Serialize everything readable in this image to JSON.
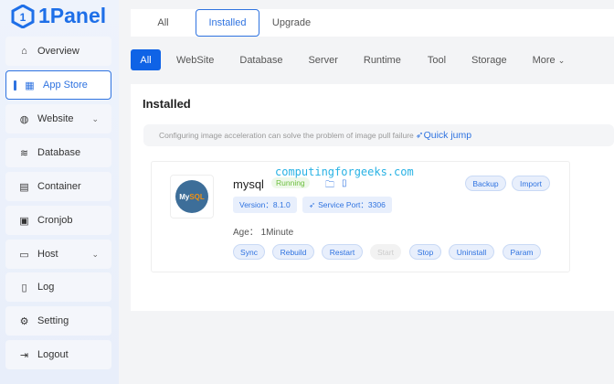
{
  "brand": {
    "name": "1Panel"
  },
  "sidebar": {
    "items": [
      {
        "label": "Overview",
        "icon": "home-icon"
      },
      {
        "label": "App Store",
        "icon": "grid-icon",
        "active": true
      },
      {
        "label": "Website",
        "icon": "globe-icon",
        "chevron": true
      },
      {
        "label": "Database",
        "icon": "database-icon"
      },
      {
        "label": "Container",
        "icon": "docker-icon"
      },
      {
        "label": "Cronjob",
        "icon": "calendar-icon"
      },
      {
        "label": "Host",
        "icon": "host-icon",
        "chevron": true
      },
      {
        "label": "Log",
        "icon": "log-icon"
      },
      {
        "label": "Setting",
        "icon": "gear-icon"
      },
      {
        "label": "Logout",
        "icon": "logout-icon"
      }
    ]
  },
  "tabs": [
    "All",
    "Installed",
    "Upgrade"
  ],
  "categories": [
    "All",
    "WebSite",
    "Database",
    "Server",
    "Runtime",
    "Tool",
    "Storage",
    "More"
  ],
  "panel": {
    "title": "Installed",
    "notice": "Configuring image acceleration can solve the problem of image pull failure",
    "notice_link": "Quick jump",
    "app": {
      "name": "mysql",
      "status": "Running",
      "logo_text": "MySQL",
      "version": "Version：8.1.0",
      "port": "Service Port：3306",
      "age": "Age：  1Minute",
      "top_actions": [
        "Backup",
        "Import"
      ],
      "actions": [
        "Sync",
        "Rebuild",
        "Restart",
        "Start",
        "Stop",
        "Uninstall",
        "Param"
      ]
    }
  },
  "watermark": "computingforgeeks.com",
  "colors": {
    "accent": "#2f73e0",
    "running": "#6cbf3d"
  }
}
